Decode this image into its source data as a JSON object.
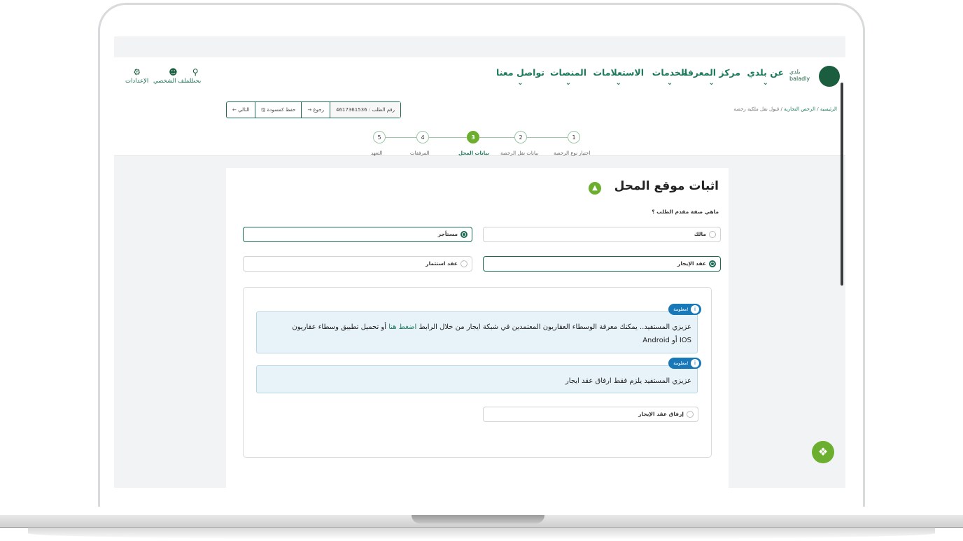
{
  "header": {
    "logo_text": "بلدي baladly",
    "nav": [
      {
        "label": "عن بلدي"
      },
      {
        "label": "مركز المعرفة"
      },
      {
        "label": "الخدمات"
      },
      {
        "label": "الاستعلامات"
      },
      {
        "label": "المنصات"
      },
      {
        "label": "تواصل معنا"
      }
    ],
    "utils": [
      {
        "label": "بحث",
        "icon": "search-icon"
      },
      {
        "label": "الملف الشخصي",
        "icon": "user-icon"
      },
      {
        "label": "الإعدادات",
        "icon": "gear-icon"
      }
    ]
  },
  "breadcrumb": {
    "home": "الرئيسية",
    "sep": "/",
    "section": "الرخص التجارية",
    "current": "قبول نقل ملكية رخصة"
  },
  "toolbar": {
    "request_no": "رقم الطلب : 4617361536",
    "back": "رجوع",
    "save_draft": "حفظ كمسودة",
    "next": "التالي"
  },
  "steps": [
    {
      "num": "1",
      "label": "اختيار نوع الرخصة"
    },
    {
      "num": "2",
      "label": "بيانات نقل الرخصة"
    },
    {
      "num": "3",
      "label": "بيانات المحل"
    },
    {
      "num": "4",
      "label": "المرفقات"
    },
    {
      "num": "5",
      "label": "التعهد"
    }
  ],
  "active_step": 3,
  "form": {
    "title": "اثبات موقع المحل",
    "question": "ماهي صفة مقدم الطلب ؟",
    "applicant_options": [
      {
        "label": "مالك",
        "selected": false
      },
      {
        "label": "مستأجر",
        "selected": true
      }
    ],
    "contract_options": [
      {
        "label": "عقد الإيجار",
        "selected": true
      },
      {
        "label": "عقد استثمار",
        "selected": false
      }
    ],
    "info_badge": "معلومة!",
    "info1_text": "عزيزي المستفيد.. يمكنك معرفة الوسطاء العقاريون المعتمدين في شبكة ايجار من خلال الرابط",
    "info1_link": "اضغط هنا",
    "info1_tail": "أو تحميل تطبيق وسطاء عقاريون",
    "info1_line2": "IOS أو Android",
    "info2_text": "عزيزي المستفيد يلزم فقط ارفاق عقد ايجار",
    "attach_label": "إرفاق عقد الإيجار"
  },
  "colors": {
    "brand": "#1c7a5a",
    "accent": "#6cae2e",
    "info": "#1979b8"
  }
}
